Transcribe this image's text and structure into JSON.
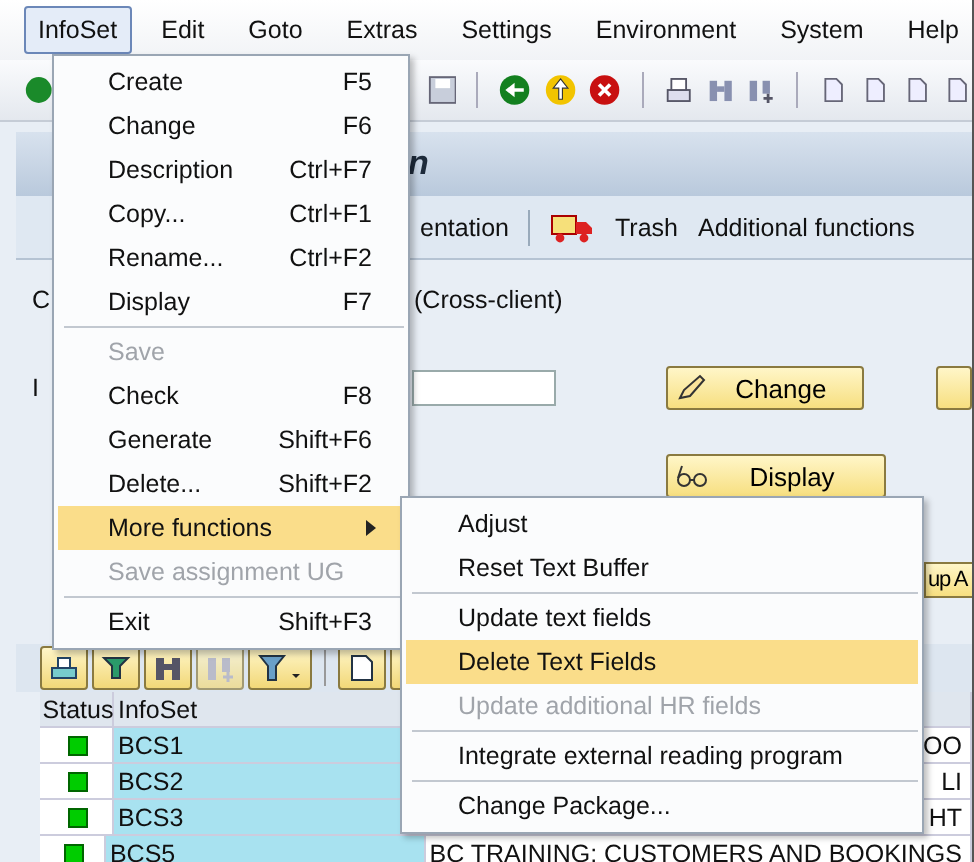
{
  "menubar": [
    {
      "label": "InfoSet",
      "selected": true
    },
    {
      "label": "Edit",
      "selected": false
    },
    {
      "label": "Goto",
      "selected": false
    },
    {
      "label": "Extras",
      "selected": false
    },
    {
      "label": "Settings",
      "selected": false
    },
    {
      "label": "Environment",
      "selected": false
    },
    {
      "label": "System",
      "selected": false
    },
    {
      "label": "Help",
      "selected": false
    }
  ],
  "title": "n",
  "app_toolbar": [
    {
      "kind": "text",
      "label": "entation"
    },
    {
      "kind": "separator"
    },
    {
      "kind": "truck"
    },
    {
      "kind": "text",
      "label": "Trash"
    },
    {
      "kind": "text",
      "label": "Additional functions"
    }
  ],
  "form": {
    "label_1": "C",
    "scope": "(Cross-client)",
    "label_2": "I",
    "change_button": "Change",
    "display_button": "Display",
    "partial_button": "up A"
  },
  "table": {
    "columns": [
      "Status",
      "InfoSet"
    ],
    "rows": [
      {
        "color": "#00cc00",
        "infoset": "BCS1",
        "column_3": "OO"
      },
      {
        "color": "#00cc00",
        "infoset": "BCS2",
        "column_3": "LI"
      },
      {
        "color": "#00cc00",
        "infoset": "BCS3",
        "column_3": "HT"
      },
      {
        "color": "#00cc00",
        "infoset": "BCS5",
        "column_3": "BC TRAINING: CUSTOMERS AND BOOKINGS"
      }
    ]
  },
  "menu": [
    {
      "kind": "item",
      "label": "Create",
      "shortcut": "F5",
      "disabled": false,
      "selected": false,
      "submenu": false
    },
    {
      "kind": "item",
      "label": "Change",
      "shortcut": "F6",
      "disabled": false,
      "selected": false,
      "submenu": false
    },
    {
      "kind": "item",
      "label": "Description",
      "shortcut": "Ctrl+F7",
      "disabled": false,
      "selected": false,
      "submenu": false
    },
    {
      "kind": "item",
      "label": "Copy...",
      "shortcut": "Ctrl+F1",
      "disabled": false,
      "selected": false,
      "submenu": false
    },
    {
      "kind": "item",
      "label": "Rename...",
      "shortcut": "Ctrl+F2",
      "disabled": false,
      "selected": false,
      "submenu": false
    },
    {
      "kind": "item",
      "label": "Display",
      "shortcut": "F7",
      "disabled": false,
      "selected": false,
      "submenu": false
    },
    {
      "kind": "separator"
    },
    {
      "kind": "item",
      "label": "Save",
      "disabled": true,
      "selected": false,
      "submenu": false
    },
    {
      "kind": "item",
      "label": "Check",
      "shortcut": "F8",
      "disabled": false,
      "selected": false,
      "submenu": false
    },
    {
      "kind": "item",
      "label": "Generate",
      "shortcut": "Shift+F6",
      "disabled": false,
      "selected": false,
      "submenu": false
    },
    {
      "kind": "item",
      "label": "Delete...",
      "shortcut": "Shift+F2",
      "disabled": false,
      "selected": false,
      "submenu": false
    },
    {
      "kind": "item",
      "label": "More functions",
      "disabled": false,
      "selected": true,
      "submenu": true
    },
    {
      "kind": "item",
      "label": "Save assignment UG",
      "disabled": true,
      "selected": false,
      "submenu": false
    },
    {
      "kind": "separator"
    },
    {
      "kind": "item",
      "label": "Exit",
      "shortcut": "Shift+F3",
      "disabled": false,
      "selected": false,
      "submenu": false
    }
  ],
  "submenu": [
    {
      "kind": "item",
      "label": "Adjust",
      "disabled": false,
      "selected": false
    },
    {
      "kind": "item",
      "label": "Reset Text Buffer",
      "disabled": false,
      "selected": false
    },
    {
      "kind": "separator"
    },
    {
      "kind": "item",
      "label": "Update text fields",
      "disabled": false,
      "selected": false
    },
    {
      "kind": "item",
      "label": "Delete Text Fields",
      "disabled": false,
      "selected": true
    },
    {
      "kind": "item",
      "label": "Update additional HR fields",
      "disabled": true,
      "selected": false
    },
    {
      "kind": "separator"
    },
    {
      "kind": "item",
      "label": "Integrate external reading program",
      "disabled": false,
      "selected": false
    },
    {
      "kind": "separator"
    },
    {
      "kind": "item",
      "label": "Change Package...",
      "disabled": false,
      "selected": false
    }
  ]
}
